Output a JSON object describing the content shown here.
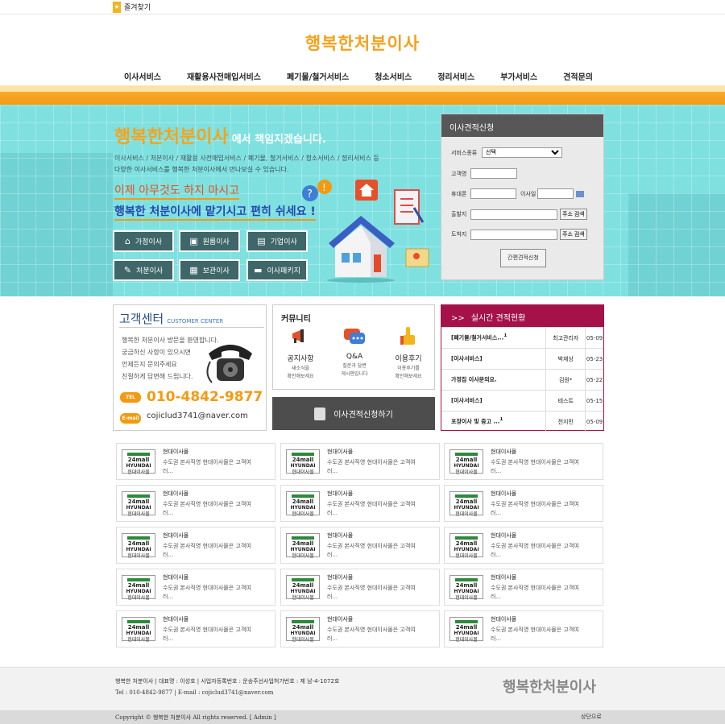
{
  "topbar": {
    "favorites": "즐겨찾기",
    "star": "★"
  },
  "logo": "행복한처분이사",
  "nav": [
    "이사서비스",
    "재활용사전매입서비스",
    "폐기물/철거서비스",
    "청소서비스",
    "정리서비스",
    "부가서비스",
    "견적문의"
  ],
  "hero": {
    "title": "행복한처분이사",
    "title_tail": "에서 책임지겠습니다.",
    "desc1": "이사서비스 / 처분이사 / 재활용 사전매입서비스 / 폐기물, 철거서비스 / 청소서비스 / 정리서비스 등",
    "desc2": "다양한 이사서비스를 행복한 처분이사에서 만나보실 수 있습니다.",
    "slogan1": "이제 아무것도 하지 마시고",
    "slogan2": "행복한 처분이사에 맡기시고 편히 쉬세요 !",
    "buttons": [
      {
        "label": "가정이사",
        "icon": "⌂"
      },
      {
        "label": "원룸이사",
        "icon": "▣"
      },
      {
        "label": "기업이사",
        "icon": "▤"
      },
      {
        "label": "처분이사",
        "icon": "✎"
      },
      {
        "label": "보관이사",
        "icon": "▦"
      },
      {
        "label": "이사패키지",
        "icon": "▬"
      }
    ]
  },
  "quote_form": {
    "title": "이사견적신청",
    "service_label": "서비스종류",
    "service_selected": "선택",
    "name_label": "고객명",
    "phone_label": "휴대폰",
    "date_label": "이사일",
    "origin_label": "출발지",
    "dest_label": "도착지",
    "addr_btn": "주소 검색",
    "submit": "간편견적신청"
  },
  "customer_center": {
    "title": "고객센터",
    "subtitle": "CUSTOMER CENTER",
    "lines": [
      "행복한 처분이사 방문을 환영합니다.",
      "궁금하신 사항이 있으시면",
      "언제든지 문의주세요",
      "친절하게 답변해 드립니다."
    ],
    "tel_badge": "TEL",
    "tel": "010-4842-9877",
    "mail_badge": "E-mail",
    "email": "cojiclud3741@naver.com"
  },
  "community": {
    "title": "커뮤니티",
    "items": [
      {
        "label": "공지사항",
        "sub1": "새소식을",
        "sub2": "확인해보세요"
      },
      {
        "label": "Q&A",
        "sub1": "질문과 답변",
        "sub2": "게시판입니다"
      },
      {
        "label": "이용후기",
        "sub1": "이용후기를",
        "sub2": "확인해보세요"
      }
    ]
  },
  "quote_big_btn": "이사견적신청하기",
  "realtime": {
    "title": "실시간 견적현황",
    "arrow": ">>",
    "rows": [
      {
        "title": "[폐기물/철거서비스...",
        "badge": "1",
        "name": "최고관리자",
        "date": "05-09"
      },
      {
        "title": "[이사서비스]",
        "badge": "",
        "name": "박재상",
        "date": "05-23"
      },
      {
        "title": "가정집 이사문의요.",
        "badge": "",
        "name": "김원*",
        "date": "05-22"
      },
      {
        "title": "[이사서비스]",
        "badge": "",
        "name": "테스트",
        "date": "05-15"
      },
      {
        "title": "포장이사 및 중고 ...",
        "badge": "1",
        "name": "전지민",
        "date": "05-09"
      }
    ]
  },
  "partners": {
    "logo_top": "24mall",
    "logo_mid": "HYUNDAI",
    "logo_bot": "현대이사몰",
    "name": "현대이사몰",
    "desc": "수도권 본사직영 현대이사몰은 고객여러..."
  },
  "footer": {
    "line1": "행복한 처분이사 | 대표명 : 이성호 | 사업자등록번호 : 운송주선사업허가번호 : 제 남-4-1072호",
    "line2": "Tel : 010-4842-9877 | E-mail : cojiclud3741@naver.com",
    "logo": "행복한처분이사",
    "copyright": "Copyright © 행복한 처분이사 All rights reserved. [ Admin ]",
    "top": "상단으로"
  }
}
